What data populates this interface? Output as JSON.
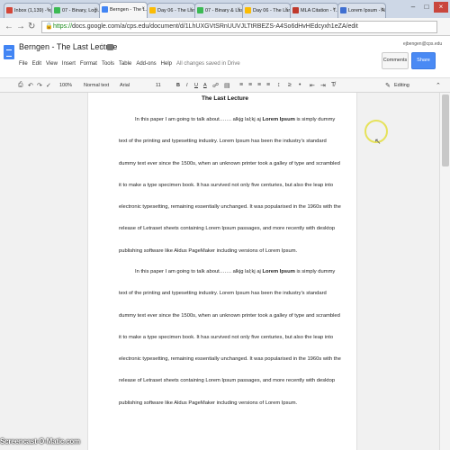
{
  "browser": {
    "tabs": [
      {
        "label": "Inbox (1,139) - ej...",
        "color": "#d44638"
      },
      {
        "label": "07 - Binary, Logi...",
        "color": "#3cba54"
      },
      {
        "label": "Berngen - The L...",
        "color": "#4285f4",
        "active": true
      },
      {
        "label": "Day 06 - The Lan...",
        "color": "#fbbc05"
      },
      {
        "label": "07 - Binary & Las...",
        "color": "#3cba54"
      },
      {
        "label": "Day 06 - The Lan...",
        "color": "#fbbc05"
      },
      {
        "label": "MLA Citation - T...",
        "color": "#c0392b"
      },
      {
        "label": "Lorem Ipsum - Al...",
        "color": "#3f6fd1"
      }
    ],
    "url_scheme": "https://",
    "url_rest": "docs.google.com/a/cps.edu/document/d/1LhUXGVtSRnUUVJLTtRBEZS-A4So6dHvHEdcyxh1eZA/edit"
  },
  "doc": {
    "title": "Berngen - The Last Lecture",
    "menu": [
      "File",
      "Edit",
      "View",
      "Insert",
      "Format",
      "Tools",
      "Table",
      "Add-ons",
      "Help"
    ],
    "saved_status": "All changes saved in Drive",
    "user_email": "ejbengen@cps.edu",
    "comments_label": "Comments",
    "share_label": "Share"
  },
  "toolbar": {
    "zoom": "100%",
    "style": "Normal text",
    "font": "Arial",
    "size": "11",
    "bold": "B",
    "italic": "I",
    "underline": "U",
    "text_color": "A",
    "mode": "Editing"
  },
  "content": {
    "heading": "The Last Lecture",
    "lines": [
      {
        "text": "In this paper I am going to talk about……. alkjg lal;kj aj ",
        "bold": "Lorem Ipsum",
        "after": " is simply dummy",
        "indent": true
      },
      {
        "text": "text of the printing and typesetting industry. Lorem Ipsum has been the industry's standard"
      },
      {
        "text": "dummy text ever since the 1500s, when an unknown printer took a galley of type and scrambled"
      },
      {
        "text": "it to make a type specimen book. It has survived not only five centuries, but also the leap into"
      },
      {
        "text": "electronic typesetting, remaining essentially unchanged. It was popularised in the 1960s with the"
      },
      {
        "text": "release of Letraset sheets containing Lorem Ipsum passages, and more recently with desktop"
      },
      {
        "text": "publishing software like Aldus PageMaker including versions of Lorem Ipsum."
      },
      {
        "text": "In this paper I am going to talk about……. alkjg lal;kj aj ",
        "bold": "Lorem Ipsum",
        "after": " is simply dummy",
        "indent": true
      },
      {
        "text": "text of the printing and typesetting industry. Lorem Ipsum has been the industry's standard"
      },
      {
        "text": "dummy text ever since the 1500s, when an unknown printer took a galley of type and scrambled"
      },
      {
        "text": "it to make a type specimen book. It has survived not only five centuries, but also the leap into"
      },
      {
        "text": "electronic typesetting, remaining essentially unchanged. It was popularised in the 1960s with the"
      },
      {
        "text": "release of Letraset sheets containing Lorem Ipsum passages, and more recently with desktop"
      },
      {
        "text": "publishing software like Aldus PageMaker including versions of Lorem Ipsum."
      }
    ]
  },
  "watermark": "Screencast-O-Matic.com"
}
